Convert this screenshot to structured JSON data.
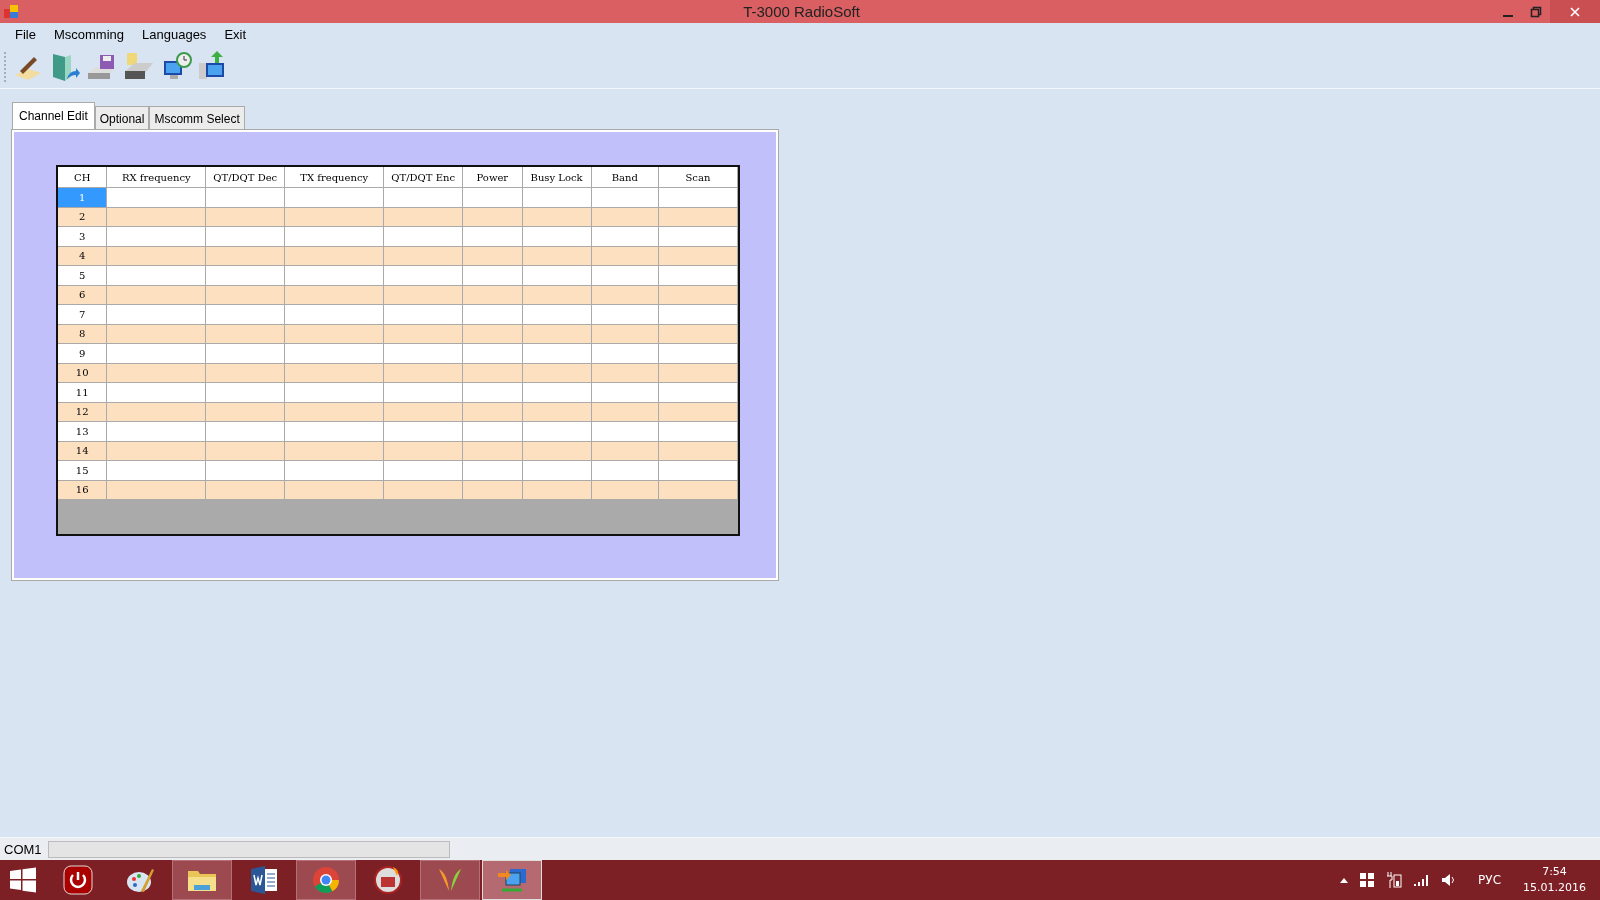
{
  "window": {
    "title": "T-3000 RadioSoft"
  },
  "menu": [
    "File",
    "Mscomming",
    "Languages",
    "Exit"
  ],
  "toolbar": [
    {
      "kind": "write"
    },
    {
      "kind": "import"
    },
    {
      "kind": "save"
    },
    {
      "kind": "print"
    },
    {
      "kind": "read"
    },
    {
      "kind": "upload"
    }
  ],
  "tabs": [
    {
      "label": "Channel Edit",
      "selected": true
    },
    {
      "label": "Optional",
      "selected": false
    },
    {
      "label": "Mscomm Select",
      "selected": false
    }
  ],
  "table": {
    "columns": [
      "CH",
      "RX frequency",
      "QT/DQT Dec",
      "TX frequency",
      "QT/DQT Enc",
      "Power",
      "Busy Lock",
      "Band",
      "Scan"
    ],
    "rows": [
      {
        "ch": "1",
        "selected": true
      },
      {
        "ch": "2",
        "selected": false
      },
      {
        "ch": "3",
        "selected": false
      },
      {
        "ch": "4",
        "selected": false
      },
      {
        "ch": "5",
        "selected": false
      },
      {
        "ch": "6",
        "selected": false
      },
      {
        "ch": "7",
        "selected": false
      },
      {
        "ch": "8",
        "selected": false
      },
      {
        "ch": "9",
        "selected": false
      },
      {
        "ch": "10",
        "selected": false
      },
      {
        "ch": "11",
        "selected": false
      },
      {
        "ch": "12",
        "selected": false
      },
      {
        "ch": "13",
        "selected": false
      },
      {
        "ch": "14",
        "selected": false
      },
      {
        "ch": "15",
        "selected": false
      },
      {
        "ch": "16",
        "selected": false
      }
    ]
  },
  "status_bar": {
    "port": "COM1",
    "progress": {
      "level": 0
    }
  },
  "taskbar": {
    "items": [
      {
        "kind": "power",
        "running": false,
        "selected": false
      },
      {
        "kind": "paint",
        "running": false,
        "selected": false
      },
      {
        "kind": "folder",
        "running": true,
        "selected": false
      },
      {
        "kind": "word",
        "running": false,
        "selected": false
      },
      {
        "kind": "chrome",
        "running": true,
        "selected": false
      },
      {
        "kind": "game",
        "running": false,
        "selected": false
      },
      {
        "kind": "butterfly",
        "running": true,
        "selected": false
      },
      {
        "kind": "network",
        "running": true,
        "selected": true
      }
    ],
    "language": "РУС",
    "time": "7:54",
    "date": "15.01.2016"
  }
}
